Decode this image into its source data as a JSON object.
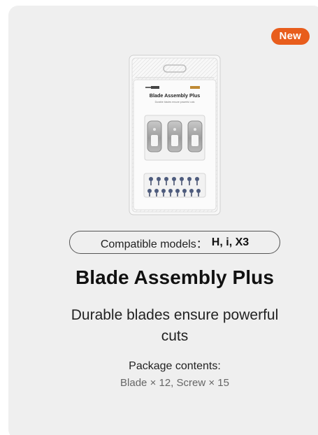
{
  "card": {
    "badge": "New",
    "compatible_label": "Compatible models：",
    "compatible_models": "H, i, X3",
    "title": "Blade Assembly Plus",
    "subtitle": "Durable blades ensure powerful cuts",
    "package_label": "Package contents:",
    "package_value": "Blade × 12, Screw × 15"
  },
  "colors": {
    "card_background": "#efefef",
    "badge_background": "#e85d1c",
    "text_primary": "#111111",
    "text_secondary": "#666666"
  },
  "icons": {
    "product": "blade-assembly-package-image"
  }
}
